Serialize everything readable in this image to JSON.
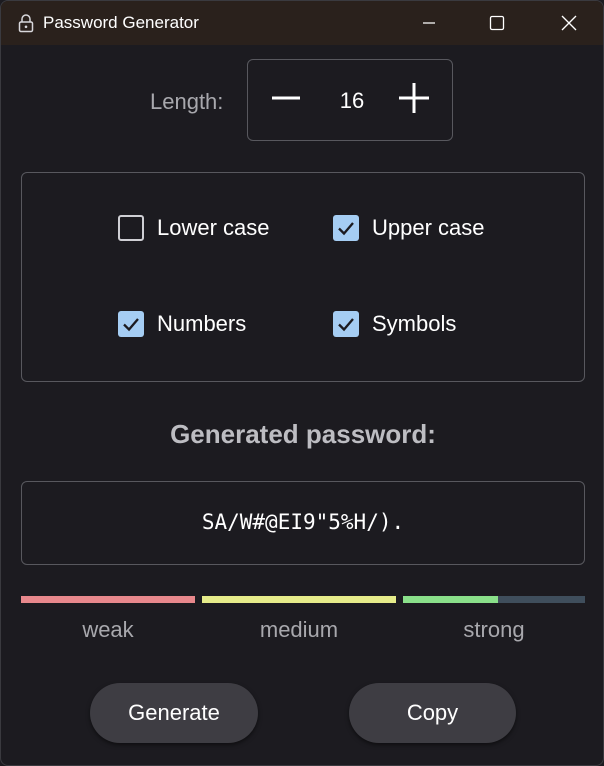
{
  "window": {
    "title": "Password Generator",
    "title_icon": "lock-icon",
    "controls": [
      "minimize-icon",
      "maximize-icon",
      "close-icon"
    ]
  },
  "length": {
    "label": "Length:",
    "value": "16",
    "decrement_icon": "minus-icon",
    "increment_icon": "plus-icon"
  },
  "options": [
    {
      "label": "Lower case",
      "checked": false
    },
    {
      "label": "Upper case",
      "checked": true
    },
    {
      "label": "Numbers",
      "checked": true
    },
    {
      "label": "Symbols",
      "checked": true
    }
  ],
  "output": {
    "label": "Generated password:",
    "password": "SA/W#@EI9\"5%H/)."
  },
  "strength": {
    "levels": [
      "weak",
      "medium",
      "strong"
    ],
    "strong_fill_fraction": 0.52,
    "colors": {
      "weak": "#e8888c",
      "medium": "#e6ec8a",
      "strong": "#8ae08a",
      "track": "#3f4e5c"
    }
  },
  "actions": {
    "generate_label": "Generate",
    "copy_label": "Copy"
  },
  "colors": {
    "background": "#1c1b20",
    "titlebar": "#2a211c",
    "checkbox_accent": "#a5cdf3",
    "button": "#3e3d43"
  }
}
